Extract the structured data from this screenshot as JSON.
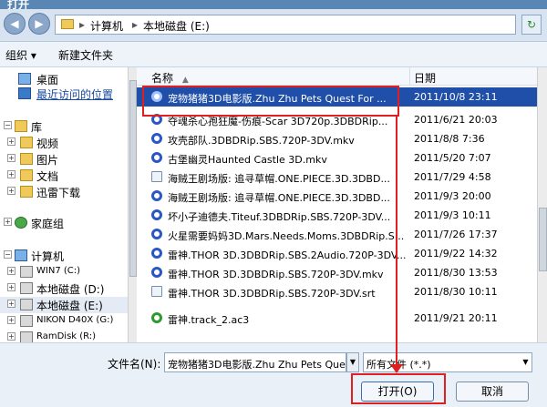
{
  "window": {
    "title": "打开"
  },
  "address": {
    "crumbs": [
      "计算机",
      "本地磁盘 (E:)"
    ],
    "back": "◀",
    "forward": "▶",
    "refresh": "↻"
  },
  "toolbar": {
    "organize": "组织 ▾",
    "new_folder": "新建文件夹"
  },
  "nav": {
    "items": [
      {
        "label": "桌面"
      },
      {
        "label": "最近访问的位置"
      },
      {
        "label": "库"
      },
      {
        "label": "视频"
      },
      {
        "label": "图片"
      },
      {
        "label": "文档"
      },
      {
        "label": "迅雷下载"
      },
      {
        "label": "家庭组"
      },
      {
        "label": "计算机"
      },
      {
        "label": "WIN7 (C:)"
      },
      {
        "label": "本地磁盘 (D:)"
      },
      {
        "label": "本地磁盘 (E:)"
      },
      {
        "label": "NIKON D40X (G:)"
      },
      {
        "label": "RamDisk (R:)"
      }
    ]
  },
  "columns": {
    "name": "名称",
    "date": "日期"
  },
  "files": [
    {
      "name": "宠物猪猪3D电影版.Zhu Zhu Pets Quest For ...",
      "date": "2011/10/8 23:11"
    },
    {
      "name": "夺魂杀心孢狂魔-伤痕-Scar 3D720p.3DBDRip...",
      "date": "2011/6/21 20:03"
    },
    {
      "name": "攻壳部队.3DBDRip.SBS.720P-3DV.mkv",
      "date": "2011/8/8 7:36"
    },
    {
      "name": "古堡幽灵Haunted Castle 3D.mkv",
      "date": "2011/5/20 7:07"
    },
    {
      "name": "海贼王剧场版: 追寻草帽.ONE.PIECE.3D.3DBD...",
      "date": "2011/7/29 4:58"
    },
    {
      "name": "海贼王剧场版: 追寻草帽.ONE.PIECE.3D.3DBD...",
      "date": "2011/9/3 20:00"
    },
    {
      "name": "坏小子迪德夫.Titeuf.3DBDRip.SBS.720P-3DV...",
      "date": "2011/9/3 10:11"
    },
    {
      "name": "火星需要妈妈3D.Mars.Needs.Moms.3DBDRip.S...",
      "date": "2011/7/26 17:37"
    },
    {
      "name": "雷神.THOR 3D.3DBDRip.SBS.2Audio.720P-3DV...",
      "date": "2011/9/22 14:32"
    },
    {
      "name": "雷神.THOR 3D.3DBDRip.SBS.720P-3DV.mkv",
      "date": "2011/8/30 13:53"
    },
    {
      "name": "雷神.THOR 3D.3DBDRip.SBS.720P-3DV.srt",
      "date": "2011/8/30 10:11"
    },
    {
      "name": "雷神.track_2.ac3",
      "date": "2011/9/21 20:11"
    }
  ],
  "bottom": {
    "filename_label": "文件名(N):",
    "filename_value": "宠物猪猪3D电影版.Zhu Zhu Pets Quest",
    "filetype_value": "所有文件 (*.*)",
    "open_label": "打开(O)",
    "cancel_label": "取消"
  },
  "colors": {
    "selection": "#1f4fa8",
    "callout": "#e02020"
  }
}
